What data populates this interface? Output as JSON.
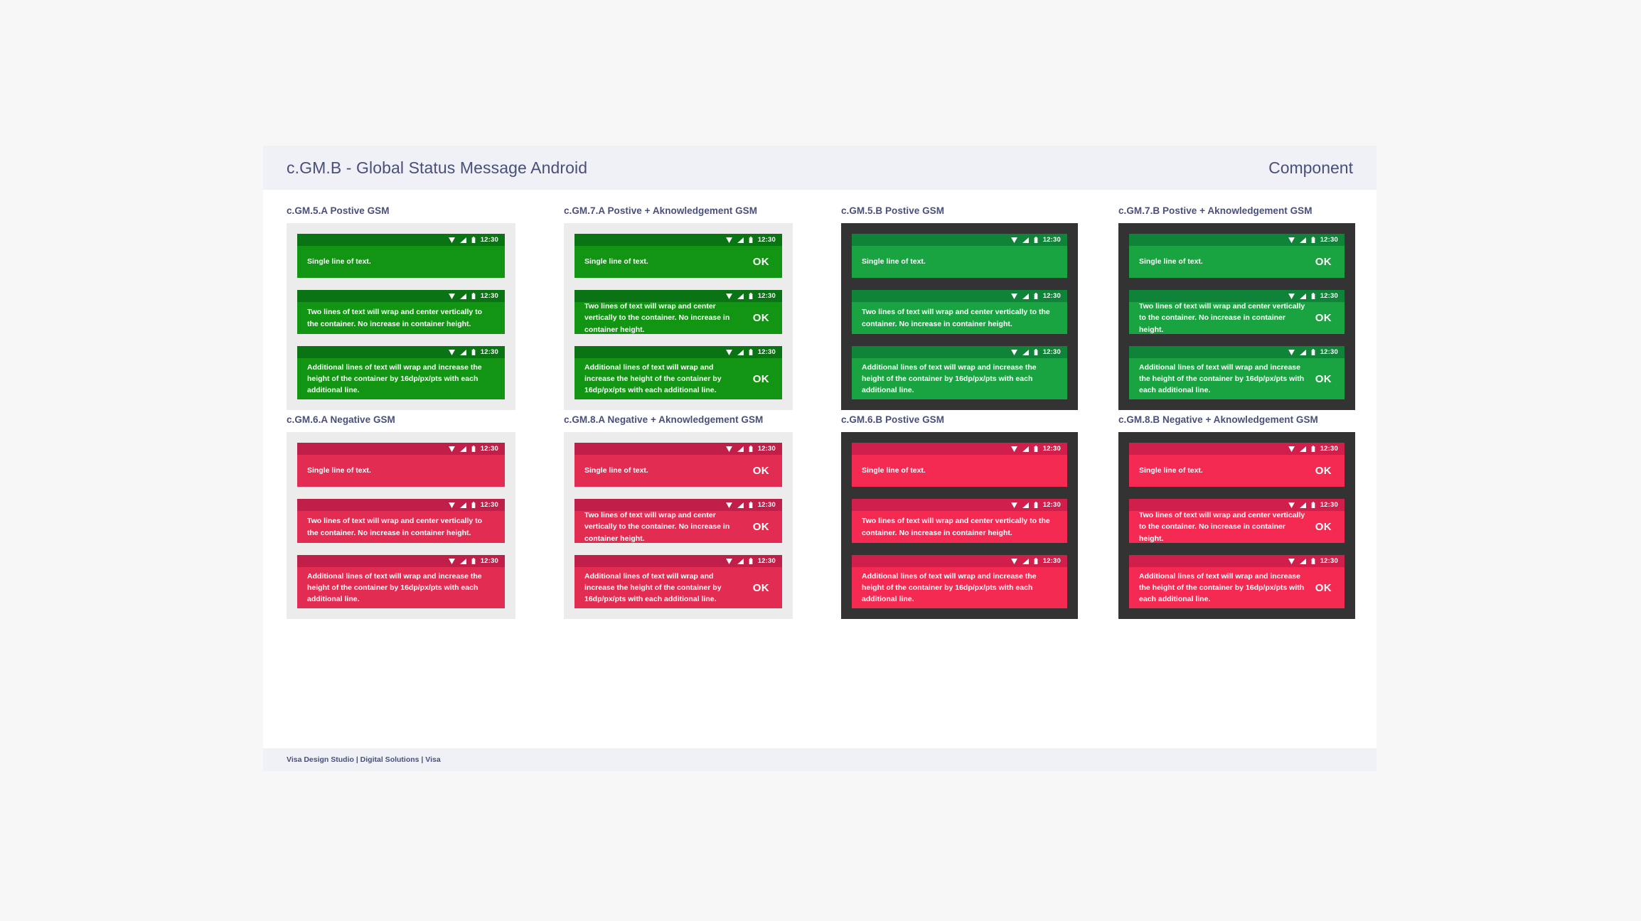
{
  "header": {
    "title": "c.GM.B - Global Status Message Android",
    "right_label": "Component"
  },
  "footer": {
    "text": "Visa Design Studio | Digital Solutions | Visa"
  },
  "status_bar": {
    "time": "12:30",
    "icons": [
      "wifi-icon",
      "signal-icon",
      "battery-icon"
    ]
  },
  "messages": {
    "single": "Single line of text.",
    "two": "Two lines of text will wrap and center vertically to the container. No increase in container height.",
    "three": "Additional lines of text will wrap and increase the height of the container by 16dp/px/pts with each additional line.",
    "ack_label": "OK"
  },
  "colors": {
    "header_bg": "#eff1f7",
    "label_text": "#4a4f7a",
    "stage_light": "#ececec",
    "stage_dark": "#333333",
    "green_a_bar": "#0a7313",
    "green_a_body": "#119513",
    "green_b_bar": "#0f8438",
    "green_b_body": "#1aa441",
    "red_a_bar": "#bf1f48",
    "red_a_body": "#e22c52",
    "red_b_bar": "#cf1f4a",
    "red_b_body": "#f52a53"
  },
  "columns": [
    {
      "id": "c-gm-5-a",
      "label": "c.GM.5.A Postive GSM",
      "stage": "light",
      "tone": "tone-green-a",
      "ack": false
    },
    {
      "id": "c-gm-7-a",
      "label": "c.GM.7.A Postive + Aknowledgement GSM",
      "stage": "light",
      "tone": "tone-green-a",
      "ack": true
    },
    {
      "id": "c-gm-5-b",
      "label": "c.GM.5.B Postive GSM",
      "stage": "dark",
      "tone": "tone-green-b",
      "ack": false
    },
    {
      "id": "c-gm-7-b",
      "label": "c.GM.7.B Postive + Aknowledgement GSM",
      "stage": "dark",
      "tone": "tone-green-b",
      "ack": true
    },
    {
      "id": "c-gm-6-a",
      "label": "c.GM.6.A Negative GSM",
      "stage": "light",
      "tone": "tone-red-a",
      "ack": false
    },
    {
      "id": "c-gm-8-a",
      "label": "c.GM.8.A Negative + Aknowledgement GSM",
      "stage": "light",
      "tone": "tone-red-a",
      "ack": true
    },
    {
      "id": "c-gm-6-b",
      "label": "c.GM.6.B Postive GSM",
      "stage": "dark",
      "tone": "tone-red-b",
      "ack": false
    },
    {
      "id": "c-gm-8-b",
      "label": "c.GM.8.B Negative + Aknowledgement GSM",
      "stage": "dark",
      "tone": "tone-red-b",
      "ack": true
    }
  ]
}
